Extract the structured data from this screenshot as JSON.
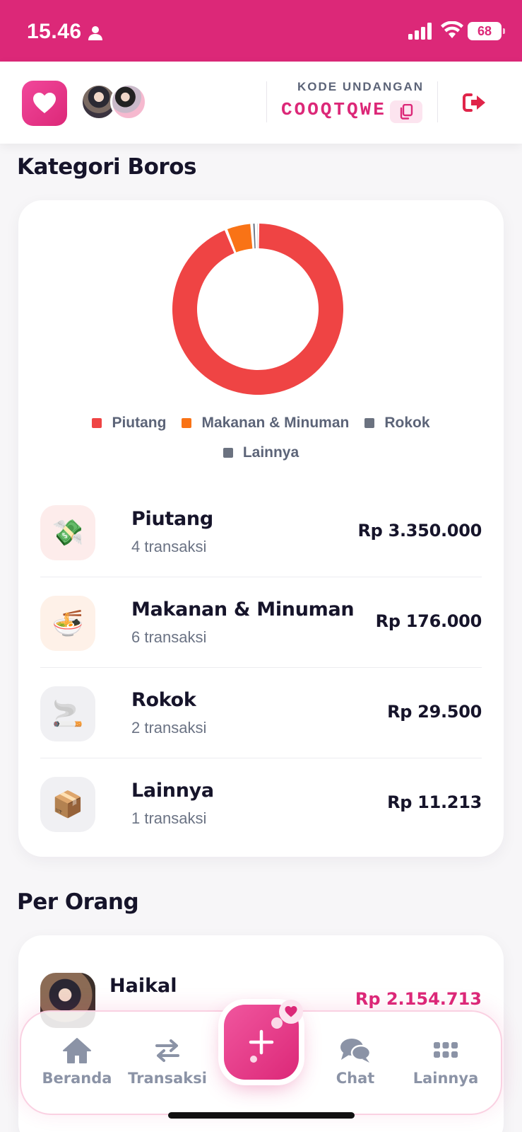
{
  "status_bar": {
    "time": "15.46",
    "battery": "68"
  },
  "header": {
    "invite_label": "KODE UNDANGAN",
    "invite_code": "COOQTQWE"
  },
  "colors": {
    "brand": "#dc2878",
    "piutang": "#ef4444",
    "makanan": "#f97316",
    "rokok": "#6b7280",
    "lainnya": "#6b7280"
  },
  "category_section": {
    "title": "Kategori Boros",
    "legend": [
      {
        "label": "Piutang",
        "color": "#ef4444"
      },
      {
        "label": "Makanan & Minuman",
        "color": "#f97316"
      },
      {
        "label": "Rokok",
        "color": "#6b7280"
      },
      {
        "label": "Lainnya",
        "color": "#6b7280"
      }
    ],
    "items": [
      {
        "name": "Piutang",
        "count": "4 transaksi",
        "amount": "Rp 3.350.000",
        "icon": "money-with-wings-icon",
        "emoji": "💸",
        "bg": "#fdeceb"
      },
      {
        "name": "Makanan & Minuman",
        "count": "6 transaksi",
        "amount": "Rp 176.000",
        "icon": "noodle-bowl-icon",
        "emoji": "🍜",
        "bg": "#fef1e8"
      },
      {
        "name": "Rokok",
        "count": "2 transaksi",
        "amount": "Rp 29.500",
        "icon": "cigarette-icon",
        "emoji": "🚬",
        "bg": "#f0f0f3"
      },
      {
        "name": "Lainnya",
        "count": "1 transaksi",
        "amount": "Rp 11.213",
        "icon": "package-icon",
        "emoji": "📦",
        "bg": "#f0f0f3"
      }
    ]
  },
  "chart_data": {
    "type": "pie",
    "categories": [
      "Piutang",
      "Makanan & Minuman",
      "Rokok",
      "Lainnya"
    ],
    "values": [
      3350000,
      176000,
      29500,
      11213
    ],
    "colors": [
      "#ef4444",
      "#f97316",
      "#6b7280",
      "#6b7280"
    ],
    "legend": "bottom"
  },
  "person_section": {
    "title": "Per Orang",
    "people": [
      {
        "name": "Haikal",
        "amount": "Rp 2.154.713"
      }
    ]
  },
  "nav": {
    "items": [
      {
        "label": "Beranda",
        "icon": "home-icon"
      },
      {
        "label": "Transaksi",
        "icon": "transfer-arrows-icon"
      },
      {
        "label": "Chat",
        "icon": "chat-bubbles-icon"
      },
      {
        "label": "Lainnya",
        "icon": "grid-dots-icon"
      }
    ],
    "fab_icon": "plus-icon"
  }
}
